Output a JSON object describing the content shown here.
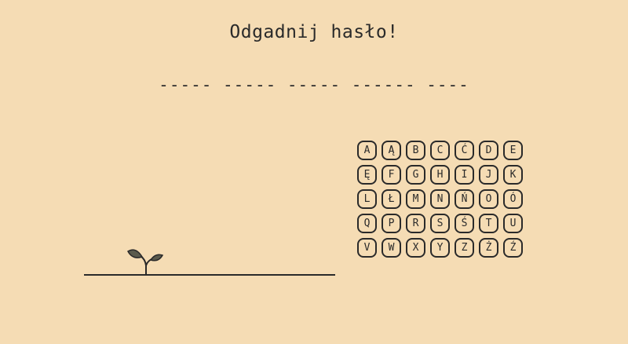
{
  "title": "Odgadnij hasło!",
  "password_mask": "----- ----- ----- ------ ----",
  "keyboard": {
    "letters": [
      "A",
      "Ą",
      "B",
      "C",
      "Ć",
      "D",
      "E",
      "Ę",
      "F",
      "G",
      "H",
      "I",
      "J",
      "K",
      "L",
      "Ł",
      "M",
      "N",
      "Ń",
      "O",
      "Ó",
      "Q",
      "P",
      "R",
      "S",
      "Ś",
      "T",
      "U",
      "V",
      "W",
      "X",
      "Y",
      "Z",
      "Ż",
      "Ź"
    ]
  },
  "scene": {
    "illustration": "sprout-icon"
  },
  "colors": {
    "background": "#f5dcb4",
    "ink": "#2a2a2a",
    "leaf": "#5a5a4c"
  }
}
